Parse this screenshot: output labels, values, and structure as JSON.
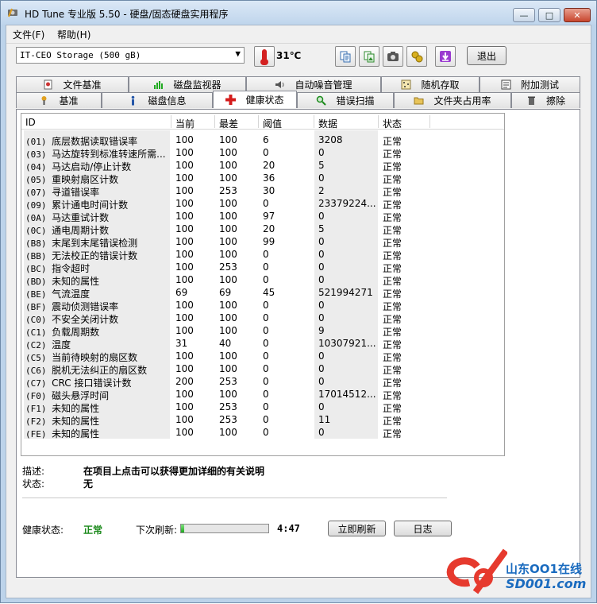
{
  "window": {
    "title": "HD Tune 专业版 5.50 - 硬盘/固态硬盘实用程序",
    "minimize": "—",
    "maximize": "□",
    "close": "✕"
  },
  "menu": [
    {
      "label": "文件(F)"
    },
    {
      "label": "帮助(H)"
    }
  ],
  "toolbar": {
    "drive": "IT-CEO  Storage (500 gB)",
    "temperature": "31℃",
    "exit_label": "退出",
    "icons": [
      "copy-text-icon",
      "copy-image-icon",
      "camera-icon",
      "options-icon",
      "download-icon"
    ]
  },
  "tabs_top": [
    {
      "label": "文件基准",
      "icon": "file-benchmark-icon"
    },
    {
      "label": "磁盘监视器",
      "icon": "disk-monitor-icon"
    },
    {
      "label": "自动噪音管理",
      "icon": "speaker-icon"
    },
    {
      "label": "随机存取",
      "icon": "random-access-icon"
    },
    {
      "label": "附加测试",
      "icon": "extra-tests-icon"
    }
  ],
  "tabs_bottom": [
    {
      "label": "基准",
      "icon": "benchmark-icon"
    },
    {
      "label": "磁盘信息",
      "icon": "info-icon"
    },
    {
      "label": "健康状态",
      "icon": "health-cross-icon",
      "active": true
    },
    {
      "label": "错误扫描",
      "icon": "magnifier-icon"
    },
    {
      "label": "文件夹占用率",
      "icon": "folder-icon"
    },
    {
      "label": "擦除",
      "icon": "trash-icon"
    }
  ],
  "table": {
    "headers": [
      "ID",
      "当前",
      "最差",
      "阈值",
      "数据",
      "状态"
    ],
    "rows": [
      {
        "id": "(01)",
        "name": "底层数据读取错误率",
        "current": "100",
        "worst": "100",
        "threshold": "6",
        "data": "3208",
        "status": "正常"
      },
      {
        "id": "(03)",
        "name": "马达旋转到标准转速所需...",
        "current": "100",
        "worst": "100",
        "threshold": "0",
        "data": "0",
        "status": "正常"
      },
      {
        "id": "(04)",
        "name": "马达启动/停止计数",
        "current": "100",
        "worst": "100",
        "threshold": "20",
        "data": "5",
        "status": "正常"
      },
      {
        "id": "(05)",
        "name": "重映射扇区计数",
        "current": "100",
        "worst": "100",
        "threshold": "36",
        "data": "0",
        "status": "正常"
      },
      {
        "id": "(07)",
        "name": "寻道错误率",
        "current": "100",
        "worst": "253",
        "threshold": "30",
        "data": "2",
        "status": "正常"
      },
      {
        "id": "(09)",
        "name": "累计通电时间计数",
        "current": "100",
        "worst": "100",
        "threshold": "0",
        "data": "23379224...",
        "status": "正常"
      },
      {
        "id": "(0A)",
        "name": "马达重试计数",
        "current": "100",
        "worst": "100",
        "threshold": "97",
        "data": "0",
        "status": "正常"
      },
      {
        "id": "(0C)",
        "name": "通电周期计数",
        "current": "100",
        "worst": "100",
        "threshold": "20",
        "data": "5",
        "status": "正常"
      },
      {
        "id": "(B8)",
        "name": "末尾到末尾错误检测",
        "current": "100",
        "worst": "100",
        "threshold": "99",
        "data": "0",
        "status": "正常"
      },
      {
        "id": "(BB)",
        "name": "无法校正的错误计数",
        "current": "100",
        "worst": "100",
        "threshold": "0",
        "data": "0",
        "status": "正常"
      },
      {
        "id": "(BC)",
        "name": "指令超时",
        "current": "100",
        "worst": "253",
        "threshold": "0",
        "data": "0",
        "status": "正常"
      },
      {
        "id": "(BD)",
        "name": "未知的属性",
        "current": "100",
        "worst": "100",
        "threshold": "0",
        "data": "0",
        "status": "正常"
      },
      {
        "id": "(BE)",
        "name": "气流温度",
        "current": "69",
        "worst": "69",
        "threshold": "45",
        "data": "521994271",
        "status": "正常"
      },
      {
        "id": "(BF)",
        "name": "震动侦测错误率",
        "current": "100",
        "worst": "100",
        "threshold": "0",
        "data": "0",
        "status": "正常"
      },
      {
        "id": "(C0)",
        "name": "不安全关闭计数",
        "current": "100",
        "worst": "100",
        "threshold": "0",
        "data": "0",
        "status": "正常"
      },
      {
        "id": "(C1)",
        "name": "负载周期数",
        "current": "100",
        "worst": "100",
        "threshold": "0",
        "data": "9",
        "status": "正常"
      },
      {
        "id": "(C2)",
        "name": "温度",
        "current": "31",
        "worst": "40",
        "threshold": "0",
        "data": "10307921...",
        "status": "正常"
      },
      {
        "id": "(C5)",
        "name": "当前待映射的扇区数",
        "current": "100",
        "worst": "100",
        "threshold": "0",
        "data": "0",
        "status": "正常"
      },
      {
        "id": "(C6)",
        "name": "脱机无法纠正的扇区数",
        "current": "100",
        "worst": "100",
        "threshold": "0",
        "data": "0",
        "status": "正常"
      },
      {
        "id": "(C7)",
        "name": "CRC 接口错误计数",
        "current": "200",
        "worst": "253",
        "threshold": "0",
        "data": "0",
        "status": "正常"
      },
      {
        "id": "(F0)",
        "name": "磁头悬浮时间",
        "current": "100",
        "worst": "100",
        "threshold": "0",
        "data": "17014512...",
        "status": "正常"
      },
      {
        "id": "(F1)",
        "name": "未知的属性",
        "current": "100",
        "worst": "253",
        "threshold": "0",
        "data": "0",
        "status": "正常"
      },
      {
        "id": "(F2)",
        "name": "未知的属性",
        "current": "100",
        "worst": "253",
        "threshold": "0",
        "data": "11",
        "status": "正常"
      },
      {
        "id": "(FE)",
        "name": "未知的属性",
        "current": "100",
        "worst": "100",
        "threshold": "0",
        "data": "0",
        "status": "正常"
      }
    ]
  },
  "details": {
    "description_label": "描述:",
    "description_value": "在项目上点击可以获得更加详细的有关说明",
    "status_label": "状态:",
    "status_value": "无"
  },
  "footer": {
    "health_label": "健康状态:",
    "health_value": "正常",
    "next_refresh_label": "下次刷新:",
    "refresh_progress": 0.04,
    "time_left": "4:47",
    "refresh_button": "立即刷新",
    "log_button": "日志"
  },
  "watermark": {
    "line1": "山东OO1在线",
    "line2": "SD001.com"
  }
}
